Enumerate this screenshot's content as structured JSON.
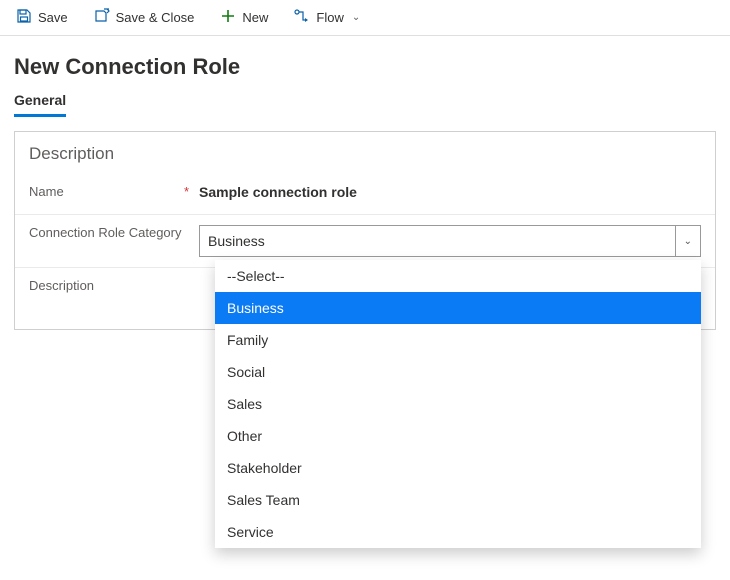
{
  "toolbar": {
    "save": "Save",
    "save_close": "Save & Close",
    "new": "New",
    "flow": "Flow"
  },
  "page_title": "New Connection Role",
  "tab": {
    "general": "General"
  },
  "section": {
    "title": "Description",
    "rows": {
      "name_label": "Name",
      "name_value": "Sample connection role",
      "category_label": "Connection Role Category",
      "category_value": "Business",
      "description_label": "Description"
    }
  },
  "dropdown": {
    "placeholder": "--Select--",
    "options": [
      "Business",
      "Family",
      "Social",
      "Sales",
      "Other",
      "Stakeholder",
      "Sales Team",
      "Service"
    ],
    "selected_index": 0
  }
}
